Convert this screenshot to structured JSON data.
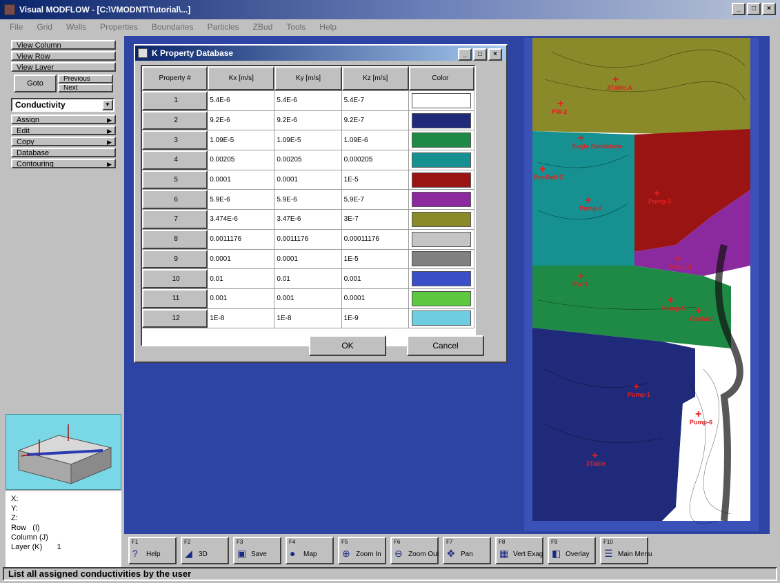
{
  "app": {
    "title": "Visual MODFLOW - [C:\\VMODNT\\Tutorial\\...]",
    "menu": [
      "File",
      "Grid",
      "Wells",
      "Properties",
      "Boundaries",
      "Particles",
      "ZBud",
      "Tools",
      "Help"
    ]
  },
  "left_panel": {
    "buttons": [
      "View Column",
      "View Row",
      "View Layer",
      "Goto",
      "Previous",
      "Next"
    ],
    "property_selector": "Conductivity",
    "menu_items": [
      "Assign",
      "Edit",
      "Copy",
      "Database",
      "Contouring"
    ]
  },
  "coords": {
    "x_label": "X:",
    "y_label": "Y:",
    "z_label": "Z:",
    "row_label": "Row",
    "row_value": "(I)",
    "column_label": "Column (J)",
    "layer_label": "Layer (K)",
    "layer_value": "1"
  },
  "dialog": {
    "title": "K Property Database",
    "columns": [
      "Property #",
      "Kx [m/s]",
      "Ky [m/s]",
      "Kz [m/s]",
      "Color"
    ],
    "rows": [
      {
        "id": "1",
        "kx": "5.4E-6",
        "ky": "5.4E-6",
        "kz": "5.4E-7",
        "color": "#ffffff"
      },
      {
        "id": "2",
        "kx": "9.2E-6",
        "ky": "9.2E-6",
        "kz": "9.2E-7",
        "color": "#1f2a7a"
      },
      {
        "id": "3",
        "kx": "1.09E-5",
        "ky": "1.09E-5",
        "kz": "1.09E-6",
        "color": "#1e8a46"
      },
      {
        "id": "4",
        "kx": "0.00205",
        "ky": "0.00205",
        "kz": "0.000205",
        "color": "#169090"
      },
      {
        "id": "5",
        "kx": "0.0001",
        "ky": "0.0001",
        "kz": "1E-5",
        "color": "#9a1414"
      },
      {
        "id": "6",
        "kx": "5.9E-6",
        "ky": "5.9E-6",
        "kz": "5.9E-7",
        "color": "#8a2a9e"
      },
      {
        "id": "7",
        "kx": "3.474E-6",
        "ky": "3.47E-6",
        "kz": "3E-7",
        "color": "#8a8a2a"
      },
      {
        "id": "8",
        "kx": "0.0011176",
        "ky": "0.0011176",
        "kz": "0.00011176",
        "color": "#c4c4c4"
      },
      {
        "id": "9",
        "kx": "0.0001",
        "ky": "0.0001",
        "kz": "1E-5",
        "color": "#808080"
      },
      {
        "id": "10",
        "kx": "0.01",
        "ky": "0.01",
        "kz": "0.001",
        "color": "#3a4ec8"
      },
      {
        "id": "11",
        "kx": "0.001",
        "ky": "0.001",
        "kz": "0.0001",
        "color": "#5cc840"
      },
      {
        "id": "12",
        "kx": "1E-8",
        "ky": "1E-8",
        "kz": "1E-9",
        "color": "#6ecde0"
      }
    ],
    "ok_label": "OK",
    "cancel_label": "Cancel"
  },
  "map": {
    "zones": [
      {
        "color": "#8a8a2a"
      },
      {
        "color": "#169090"
      },
      {
        "color": "#9a1414"
      },
      {
        "color": "#8a2a9e"
      },
      {
        "color": "#1e8a46"
      },
      {
        "color": "#1f2a7a"
      },
      {
        "color": "#ffffff"
      }
    ],
    "labels": [
      "3Table.A",
      "PW-2",
      "Eagle Sandstone",
      "Pre-Belt C",
      "Pump-2",
      "Pump-3",
      "Pump-4",
      "Pump-5",
      "Pump-1",
      "Pump-6",
      "PW-3",
      "Contact",
      "3Table"
    ],
    "label_color": "#e02020"
  },
  "toolbar": [
    {
      "fkey": "F1",
      "label": "Help",
      "icon": "help-icon"
    },
    {
      "fkey": "F2",
      "label": "3D",
      "icon": "3d-icon"
    },
    {
      "fkey": "F3",
      "label": "Save",
      "icon": "save-icon"
    },
    {
      "fkey": "F4",
      "label": "Map",
      "icon": "map-icon"
    },
    {
      "fkey": "F5",
      "label": "Zoom In",
      "icon": "zoom-in-icon"
    },
    {
      "fkey": "F6",
      "label": "Zoom Out",
      "icon": "zoom-out-icon"
    },
    {
      "fkey": "F7",
      "label": "Pan",
      "icon": "pan-icon"
    },
    {
      "fkey": "F8",
      "label": "Vert Exag",
      "icon": "vert-exag-icon"
    },
    {
      "fkey": "F9",
      "label": "Overlay",
      "icon": "overlay-icon"
    },
    {
      "fkey": "F10",
      "label": "Main Menu",
      "icon": "main-menu-icon"
    }
  ],
  "status": "List all assigned conductivities by the user"
}
